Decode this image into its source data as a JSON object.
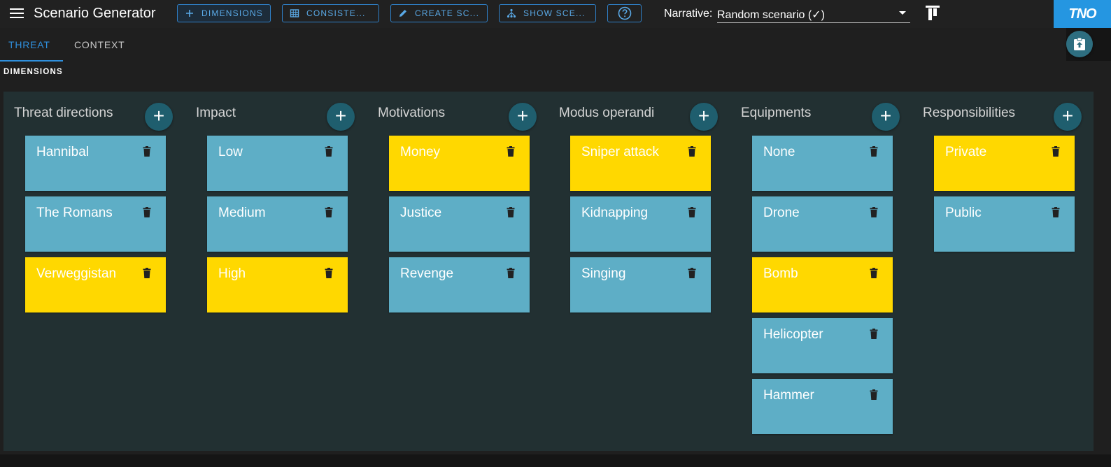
{
  "header": {
    "title": "Scenario Generator",
    "buttons": [
      {
        "label": "DIMENSIONS",
        "icon": "plus-icon"
      },
      {
        "label": "CONSISTE...",
        "icon": "table-icon"
      },
      {
        "label": "CREATE SC...",
        "icon": "pencil-icon"
      },
      {
        "label": "SHOW SCE...",
        "icon": "tree-icon"
      }
    ],
    "help_icon": "help-circle-icon",
    "narrative_label": "Narrative:",
    "narrative_value": "Random scenario (✓)",
    "logo_text": "TNO"
  },
  "tabs": [
    {
      "label": "THREAT",
      "active": true
    },
    {
      "label": "CONTEXT",
      "active": false
    }
  ],
  "section_title": "DIMENSIONS",
  "colors": {
    "selected_card": "#ffd800",
    "card": "#5eaec6",
    "board": "#223032",
    "accent": "#2f8fdc"
  },
  "dimensions": [
    {
      "title": "Threat directions",
      "items": [
        {
          "label": "Hannibal",
          "selected": false
        },
        {
          "label": "The Romans",
          "selected": false
        },
        {
          "label": "Verweggistan",
          "selected": true
        }
      ]
    },
    {
      "title": "Impact",
      "items": [
        {
          "label": "Low",
          "selected": false
        },
        {
          "label": "Medium",
          "selected": false
        },
        {
          "label": "High",
          "selected": true
        }
      ]
    },
    {
      "title": "Motivations",
      "items": [
        {
          "label": "Money",
          "selected": true
        },
        {
          "label": "Justice",
          "selected": false
        },
        {
          "label": "Revenge",
          "selected": false
        }
      ]
    },
    {
      "title": "Modus operandi",
      "items": [
        {
          "label": "Sniper attack",
          "selected": true
        },
        {
          "label": "Kidnapping",
          "selected": false
        },
        {
          "label": "Singing",
          "selected": false
        }
      ]
    },
    {
      "title": "Equipments",
      "items": [
        {
          "label": "None",
          "selected": false
        },
        {
          "label": "Drone",
          "selected": false
        },
        {
          "label": "Bomb",
          "selected": true
        },
        {
          "label": "Helicopter",
          "selected": false
        },
        {
          "label": "Hammer",
          "selected": false
        }
      ]
    },
    {
      "title": "Responsibilities",
      "items": [
        {
          "label": "Private",
          "selected": true
        },
        {
          "label": "Public",
          "selected": false
        }
      ]
    }
  ]
}
